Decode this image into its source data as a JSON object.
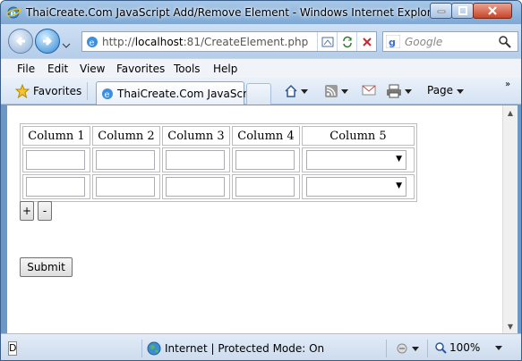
{
  "window": {
    "title": "ThaiCreate.Com JavaScript Add/Remove Element - Windows Internet Explorer"
  },
  "address": {
    "url_prefix": "http://",
    "url_host": "localhost",
    "url_rest": ":81/CreateElement.php",
    "search_placeholder": "Google"
  },
  "menu": {
    "items": [
      "File",
      "Edit",
      "View",
      "Favorites",
      "Tools",
      "Help"
    ]
  },
  "favorites": {
    "label": "Favorites",
    "tab_title": "ThaiCreate.Com JavaScr...",
    "page_label": "Page",
    "chevron": "»"
  },
  "table": {
    "headers": [
      "Column 1",
      "Column 2",
      "Column 3",
      "Column 4",
      "Column 5"
    ],
    "rows": [
      {
        "inputs": [
          "",
          "",
          "",
          ""
        ],
        "select": ""
      },
      {
        "inputs": [
          "",
          "",
          "",
          ""
        ],
        "select": ""
      }
    ]
  },
  "controls": {
    "add_label": "+",
    "remove_label": "-",
    "submit_label": "Submit"
  },
  "status": {
    "left_text": "D",
    "zone_text": "Internet | Protected Mode: On",
    "zoom": "100%"
  },
  "colors": {
    "titlebar": "#7da7d3",
    "close_button": "#c84426"
  }
}
